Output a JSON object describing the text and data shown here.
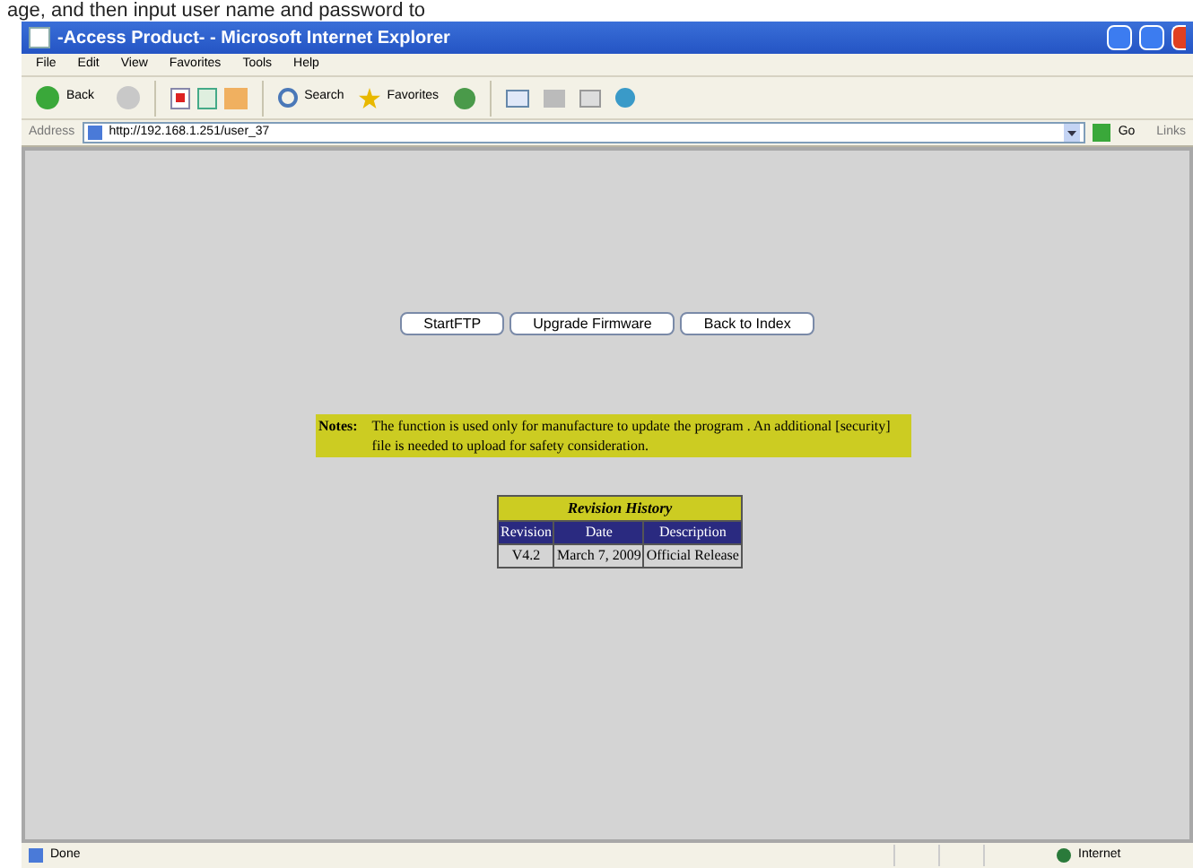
{
  "caption": "age, and then input user name and password to",
  "window": {
    "title": "-Access Product- - Microsoft Internet Explorer"
  },
  "menu": [
    "File",
    "Edit",
    "View",
    "Favorites",
    "Tools",
    "Help"
  ],
  "toolbar": {
    "back": "Back",
    "search": "Search",
    "favorites": "Favorites"
  },
  "address": {
    "label": "Address",
    "url": "http://192.168.1.251/user_37",
    "go": "Go",
    "links": "Links"
  },
  "buttons": [
    "StartFTP",
    "Upgrade Firmware",
    "Back to Index"
  ],
  "notes": {
    "label": "Notes:",
    "text": "The function is used only for manufacture to update the program . An additional [security] file is needed to upload for safety consideration."
  },
  "revision": {
    "title": "Revision History",
    "columns": [
      "Revision",
      "Date",
      "Description"
    ],
    "rows": [
      [
        "V4.2",
        "March 7, 2009",
        "Official Release"
      ]
    ]
  },
  "status": {
    "text": "Done",
    "zone": "Internet"
  }
}
